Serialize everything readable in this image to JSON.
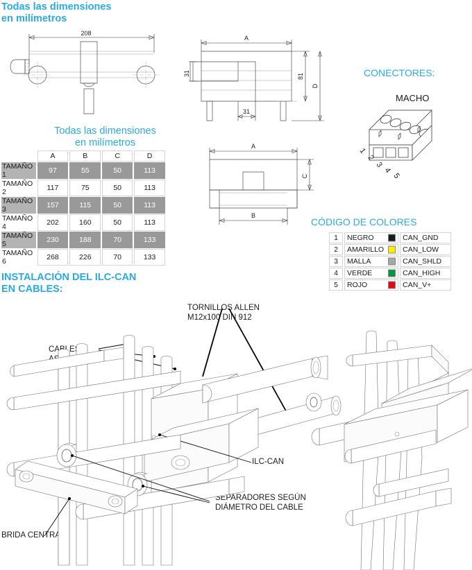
{
  "headings": {
    "dimensions_top": "Todas las dimensiones\nen milímetros",
    "dimensions_table": "Todas las dimensiones\nen milímetros",
    "connectors": "CONECTORES:",
    "color_code": "CÓDIGO DE COLORES",
    "installation": "INSTALACIÓN DEL ILC-CAN\nEN CABLES:"
  },
  "connector": {
    "type_label": "MACHO",
    "pins": [
      "1",
      "2",
      "3",
      "4",
      "5"
    ]
  },
  "drawings": {
    "top_view_dimension": "208",
    "side_view": {
      "width_label": "A",
      "height_label": "81",
      "total_height_label": "D",
      "top_offset_label": "31",
      "center_offset_label": "31"
    },
    "front_view": {
      "width_label": "A",
      "base_label": "B",
      "height_label": "C"
    }
  },
  "dim_table": {
    "columns": [
      "A",
      "B",
      "C",
      "D"
    ],
    "rows": [
      {
        "name": "TAMAÑO 1",
        "values": [
          "97",
          "55",
          "50",
          "113"
        ],
        "shaded": true
      },
      {
        "name": "TAMAÑO 2",
        "values": [
          "117",
          "75",
          "50",
          "113"
        ],
        "shaded": false
      },
      {
        "name": "TAMAÑO 3",
        "values": [
          "157",
          "115",
          "50",
          "113"
        ],
        "shaded": true
      },
      {
        "name": "TAMAÑO 4",
        "values": [
          "202",
          "160",
          "50",
          "113"
        ],
        "shaded": false
      },
      {
        "name": "TAMAÑO 5",
        "values": [
          "230",
          "188",
          "70",
          "133"
        ],
        "shaded": true
      },
      {
        "name": "TAMAÑO 6",
        "values": [
          "268",
          "226",
          "70",
          "133"
        ],
        "shaded": false
      }
    ]
  },
  "color_code": {
    "rows": [
      {
        "pin": "1",
        "color_name": "NEGRO",
        "swatch": "#1a1a1a",
        "signal": "CAN_GND"
      },
      {
        "pin": "2",
        "color_name": "AMARILLO",
        "swatch": "#ffed00",
        "signal": "CAN_LOW"
      },
      {
        "pin": "3",
        "color_name": "MALLA",
        "swatch": "#a6a6a6",
        "signal": "CAN_SHLD"
      },
      {
        "pin": "4",
        "color_name": "VERDE",
        "swatch": "#00963f",
        "signal": "CAN_HIGH"
      },
      {
        "pin": "5",
        "color_name": "ROJO",
        "swatch": "#e30613",
        "signal": "CAN_V+"
      }
    ]
  },
  "installation_labels": {
    "screws": "TORNILLOS ALLEN\nM12x100 DIN 912",
    "cables": "CABLES\nASCENSOR",
    "device": "ILC-CAN",
    "spacers": "SEPARADORES SEGÚN\nDIÁMETRO DEL CABLE",
    "clamp": "BRIDA CENTRAL"
  },
  "colors": {
    "accent_blue": "#29abe2",
    "table_shade": "#999999",
    "line": "#4d4d4d"
  }
}
